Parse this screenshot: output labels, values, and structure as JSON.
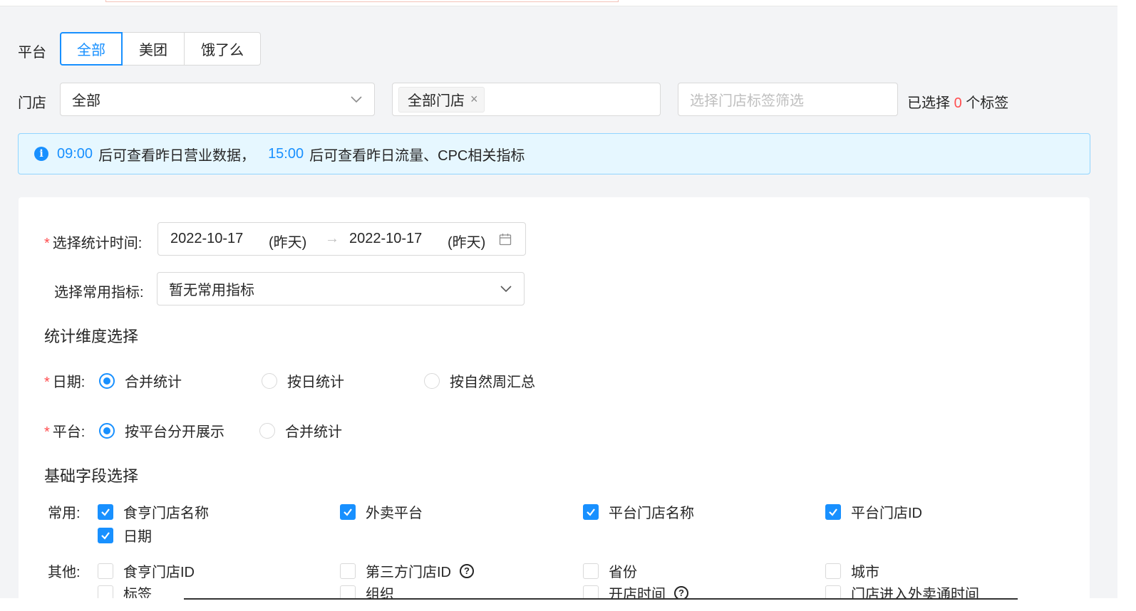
{
  "filters": {
    "platform_label": "平台",
    "platform_options": [
      "全部",
      "美团",
      "饿了么"
    ],
    "store_label": "门店",
    "store_select_value": "全部",
    "store_tag": "全部门店",
    "store_tag_remove": "×",
    "tag_filter_placeholder": "选择门店标签筛选",
    "selected_prefix": "已选择",
    "selected_count": "0",
    "selected_suffix": "个标签"
  },
  "alert": {
    "time1": "09:00",
    "text1": "后可查看昨日营业数据，",
    "time2": "15:00",
    "text2": "后可查看昨日流量、CPC相关指标"
  },
  "form": {
    "required_mark": "*",
    "time_label": "选择统计时间:",
    "date_start": "2022-10-17",
    "date_start_note": "(昨天)",
    "date_sep": "→",
    "date_end": "2022-10-17",
    "date_end_note": "(昨天)",
    "metric_label": "选择常用指标:",
    "metric_value": "暂无常用指标",
    "dimension_title": "统计维度选择",
    "date_dim_label": "日期:",
    "date_dim_options": [
      "合并统计",
      "按日统计",
      "按自然周汇总"
    ],
    "platform_dim_label": "平台:",
    "platform_dim_options": [
      "按平台分开展示",
      "合并统计"
    ],
    "fields_title": "基础字段选择",
    "common_label": "常用:",
    "common_fields": [
      "食亨门店名称",
      "外卖平台",
      "平台门店名称",
      "平台门店ID",
      "日期"
    ],
    "other_label": "其他:",
    "other_fields": [
      "食亨门店ID",
      "第三方门店ID",
      "省份",
      "城市",
      "标签",
      "组织",
      "开店时间",
      "门店进入外卖通时间"
    ],
    "help_glyph": "?"
  }
}
